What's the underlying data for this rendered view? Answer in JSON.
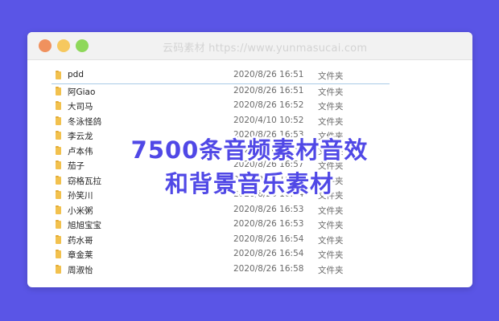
{
  "window": {
    "watermark": "云码素材 https://www.yunmasucai.com"
  },
  "files": [
    {
      "name": "pdd",
      "date": "2020/8/26 16:51",
      "type": "文件夹"
    },
    {
      "name": "阿Giao",
      "date": "2020/8/26 16:51",
      "type": "文件夹"
    },
    {
      "name": "大司马",
      "date": "2020/8/26 16:52",
      "type": "文件夹"
    },
    {
      "name": "冬泳怪鸽",
      "date": "2020/4/10 10:52",
      "type": "文件夹"
    },
    {
      "name": "李云龙",
      "date": "2020/8/26 16:53",
      "type": "文件夹"
    },
    {
      "name": "卢本伟",
      "date": "2020/8/26 16:54",
      "type": "文件夹"
    },
    {
      "name": "茄子",
      "date": "2020/8/26 16:57",
      "type": "文件夹"
    },
    {
      "name": "窃格瓦拉",
      "date": "2020/8/26 16:57",
      "type": "文件夹"
    },
    {
      "name": "孙笑川",
      "date": "2020/8/26 16:54",
      "type": "文件夹"
    },
    {
      "name": "小米粥",
      "date": "2020/8/26 16:53",
      "type": "文件夹"
    },
    {
      "name": "旭旭宝宝",
      "date": "2020/8/26 16:53",
      "type": "文件夹"
    },
    {
      "name": "药水哥",
      "date": "2020/8/26 16:54",
      "type": "文件夹"
    },
    {
      "name": "章金莱",
      "date": "2020/8/26 16:54",
      "type": "文件夹"
    },
    {
      "name": "周淑怡",
      "date": "2020/8/26 16:58",
      "type": "文件夹"
    }
  ],
  "overlay": {
    "line1": "7500条音频素材音效",
    "line2": "和背景音乐素材"
  }
}
